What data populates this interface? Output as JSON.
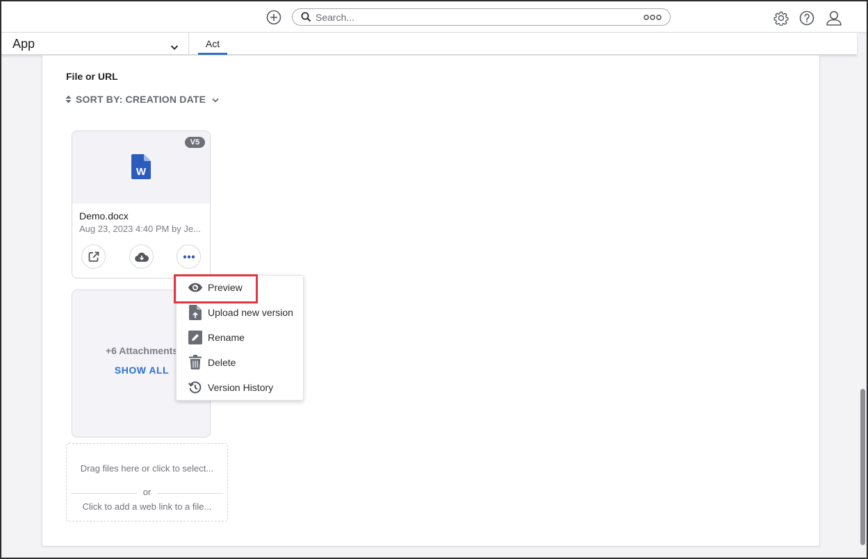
{
  "topbar": {
    "add_icon": "plus-circle-icon",
    "search_placeholder": "Search...",
    "search_more_icon": "more-options-icon",
    "settings_icon": "gear-icon",
    "help_icon": "help-icon",
    "profile_icon": "user-icon"
  },
  "subbar": {
    "app_label": "App",
    "tab_label": "Act"
  },
  "main": {
    "section_title": "File or URL",
    "sort_label": "SORT BY: CREATION DATE",
    "file": {
      "version": "V5",
      "name": "Demo.docx",
      "meta": "Aug 23, 2023 4:40 PM by Je..."
    },
    "attachments": {
      "count_label": "+6 Attachments",
      "show_all": "SHOW ALL"
    },
    "dropzone": {
      "drag_text": "Drag files here or click to select...",
      "or_text": "or",
      "link_text": "Click to add a web link to a file..."
    }
  },
  "context_menu": {
    "items": [
      {
        "label": "Preview",
        "icon": "eye-icon"
      },
      {
        "label": "Upload new version",
        "icon": "upload-file-icon"
      },
      {
        "label": "Rename",
        "icon": "pencil-icon"
      },
      {
        "label": "Delete",
        "icon": "trash-icon"
      },
      {
        "label": "Version History",
        "icon": "history-icon"
      }
    ]
  },
  "colors": {
    "accent": "#2f6fd0",
    "highlight": "#e0383e",
    "word_blue": "#2b5bbd"
  }
}
